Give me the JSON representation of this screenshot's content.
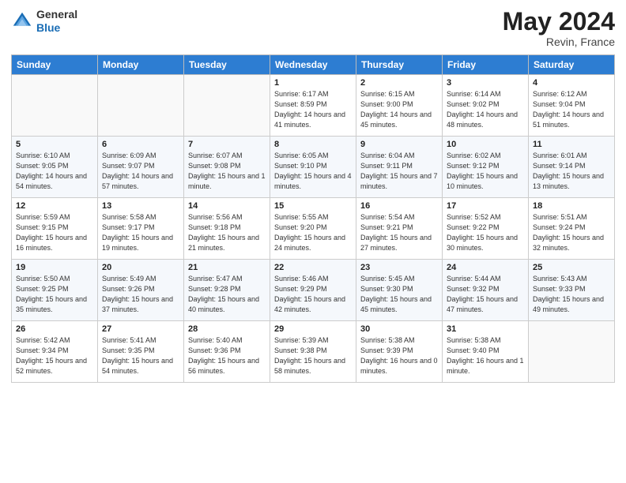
{
  "header": {
    "logo_general": "General",
    "logo_blue": "Blue",
    "month_year": "May 2024",
    "location": "Revin, France"
  },
  "days_of_week": [
    "Sunday",
    "Monday",
    "Tuesday",
    "Wednesday",
    "Thursday",
    "Friday",
    "Saturday"
  ],
  "weeks": [
    [
      {
        "day": "",
        "sunrise": "",
        "sunset": "",
        "daylight": ""
      },
      {
        "day": "",
        "sunrise": "",
        "sunset": "",
        "daylight": ""
      },
      {
        "day": "",
        "sunrise": "",
        "sunset": "",
        "daylight": ""
      },
      {
        "day": "1",
        "sunrise": "Sunrise: 6:17 AM",
        "sunset": "Sunset: 8:59 PM",
        "daylight": "Daylight: 14 hours and 41 minutes."
      },
      {
        "day": "2",
        "sunrise": "Sunrise: 6:15 AM",
        "sunset": "Sunset: 9:00 PM",
        "daylight": "Daylight: 14 hours and 45 minutes."
      },
      {
        "day": "3",
        "sunrise": "Sunrise: 6:14 AM",
        "sunset": "Sunset: 9:02 PM",
        "daylight": "Daylight: 14 hours and 48 minutes."
      },
      {
        "day": "4",
        "sunrise": "Sunrise: 6:12 AM",
        "sunset": "Sunset: 9:04 PM",
        "daylight": "Daylight: 14 hours and 51 minutes."
      }
    ],
    [
      {
        "day": "5",
        "sunrise": "Sunrise: 6:10 AM",
        "sunset": "Sunset: 9:05 PM",
        "daylight": "Daylight: 14 hours and 54 minutes."
      },
      {
        "day": "6",
        "sunrise": "Sunrise: 6:09 AM",
        "sunset": "Sunset: 9:07 PM",
        "daylight": "Daylight: 14 hours and 57 minutes."
      },
      {
        "day": "7",
        "sunrise": "Sunrise: 6:07 AM",
        "sunset": "Sunset: 9:08 PM",
        "daylight": "Daylight: 15 hours and 1 minute."
      },
      {
        "day": "8",
        "sunrise": "Sunrise: 6:05 AM",
        "sunset": "Sunset: 9:10 PM",
        "daylight": "Daylight: 15 hours and 4 minutes."
      },
      {
        "day": "9",
        "sunrise": "Sunrise: 6:04 AM",
        "sunset": "Sunset: 9:11 PM",
        "daylight": "Daylight: 15 hours and 7 minutes."
      },
      {
        "day": "10",
        "sunrise": "Sunrise: 6:02 AM",
        "sunset": "Sunset: 9:12 PM",
        "daylight": "Daylight: 15 hours and 10 minutes."
      },
      {
        "day": "11",
        "sunrise": "Sunrise: 6:01 AM",
        "sunset": "Sunset: 9:14 PM",
        "daylight": "Daylight: 15 hours and 13 minutes."
      }
    ],
    [
      {
        "day": "12",
        "sunrise": "Sunrise: 5:59 AM",
        "sunset": "Sunset: 9:15 PM",
        "daylight": "Daylight: 15 hours and 16 minutes."
      },
      {
        "day": "13",
        "sunrise": "Sunrise: 5:58 AM",
        "sunset": "Sunset: 9:17 PM",
        "daylight": "Daylight: 15 hours and 19 minutes."
      },
      {
        "day": "14",
        "sunrise": "Sunrise: 5:56 AM",
        "sunset": "Sunset: 9:18 PM",
        "daylight": "Daylight: 15 hours and 21 minutes."
      },
      {
        "day": "15",
        "sunrise": "Sunrise: 5:55 AM",
        "sunset": "Sunset: 9:20 PM",
        "daylight": "Daylight: 15 hours and 24 minutes."
      },
      {
        "day": "16",
        "sunrise": "Sunrise: 5:54 AM",
        "sunset": "Sunset: 9:21 PM",
        "daylight": "Daylight: 15 hours and 27 minutes."
      },
      {
        "day": "17",
        "sunrise": "Sunrise: 5:52 AM",
        "sunset": "Sunset: 9:22 PM",
        "daylight": "Daylight: 15 hours and 30 minutes."
      },
      {
        "day": "18",
        "sunrise": "Sunrise: 5:51 AM",
        "sunset": "Sunset: 9:24 PM",
        "daylight": "Daylight: 15 hours and 32 minutes."
      }
    ],
    [
      {
        "day": "19",
        "sunrise": "Sunrise: 5:50 AM",
        "sunset": "Sunset: 9:25 PM",
        "daylight": "Daylight: 15 hours and 35 minutes."
      },
      {
        "day": "20",
        "sunrise": "Sunrise: 5:49 AM",
        "sunset": "Sunset: 9:26 PM",
        "daylight": "Daylight: 15 hours and 37 minutes."
      },
      {
        "day": "21",
        "sunrise": "Sunrise: 5:47 AM",
        "sunset": "Sunset: 9:28 PM",
        "daylight": "Daylight: 15 hours and 40 minutes."
      },
      {
        "day": "22",
        "sunrise": "Sunrise: 5:46 AM",
        "sunset": "Sunset: 9:29 PM",
        "daylight": "Daylight: 15 hours and 42 minutes."
      },
      {
        "day": "23",
        "sunrise": "Sunrise: 5:45 AM",
        "sunset": "Sunset: 9:30 PM",
        "daylight": "Daylight: 15 hours and 45 minutes."
      },
      {
        "day": "24",
        "sunrise": "Sunrise: 5:44 AM",
        "sunset": "Sunset: 9:32 PM",
        "daylight": "Daylight: 15 hours and 47 minutes."
      },
      {
        "day": "25",
        "sunrise": "Sunrise: 5:43 AM",
        "sunset": "Sunset: 9:33 PM",
        "daylight": "Daylight: 15 hours and 49 minutes."
      }
    ],
    [
      {
        "day": "26",
        "sunrise": "Sunrise: 5:42 AM",
        "sunset": "Sunset: 9:34 PM",
        "daylight": "Daylight: 15 hours and 52 minutes."
      },
      {
        "day": "27",
        "sunrise": "Sunrise: 5:41 AM",
        "sunset": "Sunset: 9:35 PM",
        "daylight": "Daylight: 15 hours and 54 minutes."
      },
      {
        "day": "28",
        "sunrise": "Sunrise: 5:40 AM",
        "sunset": "Sunset: 9:36 PM",
        "daylight": "Daylight: 15 hours and 56 minutes."
      },
      {
        "day": "29",
        "sunrise": "Sunrise: 5:39 AM",
        "sunset": "Sunset: 9:38 PM",
        "daylight": "Daylight: 15 hours and 58 minutes."
      },
      {
        "day": "30",
        "sunrise": "Sunrise: 5:38 AM",
        "sunset": "Sunset: 9:39 PM",
        "daylight": "Daylight: 16 hours and 0 minutes."
      },
      {
        "day": "31",
        "sunrise": "Sunrise: 5:38 AM",
        "sunset": "Sunset: 9:40 PM",
        "daylight": "Daylight: 16 hours and 1 minute."
      },
      {
        "day": "",
        "sunrise": "",
        "sunset": "",
        "daylight": ""
      }
    ]
  ]
}
